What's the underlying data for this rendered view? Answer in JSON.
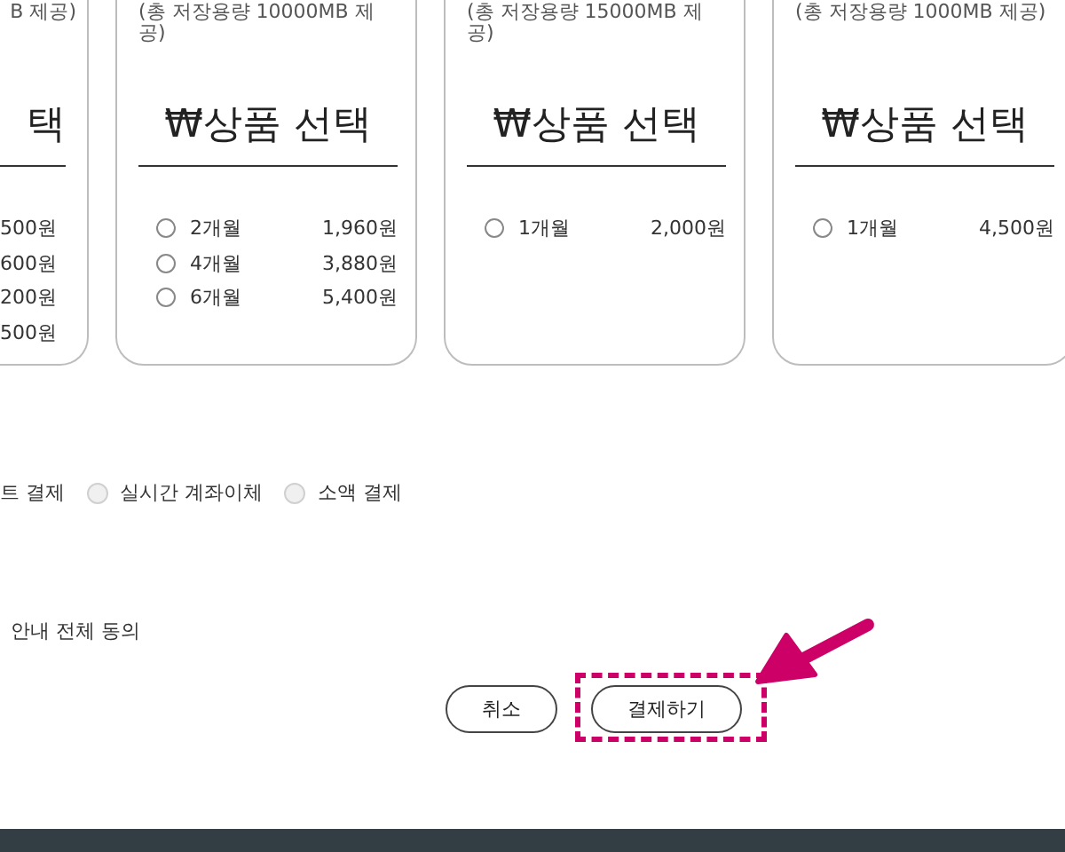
{
  "plan_cards": [
    {
      "kind": "cut",
      "storage_note": "B 제공)",
      "title": "택",
      "options": [
        {
          "price": "500원"
        },
        {
          "price": "600원"
        },
        {
          "price": "200원"
        },
        {
          "price": "500원"
        }
      ]
    },
    {
      "kind": "full",
      "storage_note": "(총 저장용량 10000MB 제공)",
      "title": "₩상품 선택",
      "options": [
        {
          "period": "2개월",
          "price": "1,960원",
          "selected": false
        },
        {
          "period": "4개월",
          "price": "3,880원",
          "selected": false
        },
        {
          "period": "6개월",
          "price": "5,400원",
          "selected": false
        }
      ]
    },
    {
      "kind": "full",
      "storage_note": "(총 저장용량 15000MB 제공)",
      "title": "₩상품 선택",
      "options": [
        {
          "period": "1개월",
          "price": "2,000원",
          "selected": false
        }
      ]
    },
    {
      "kind": "full",
      "storage_note": "(총 저장용량 1000MB 제공)",
      "title": "₩상품 선택",
      "options": [
        {
          "period": "1개월",
          "price": "4,500원",
          "selected": false
        }
      ]
    }
  ],
  "payment_methods": [
    {
      "kind": "cut",
      "label": "트 결제"
    },
    {
      "kind": "option",
      "label": "실시간 계좌이체",
      "selected": false
    },
    {
      "kind": "option",
      "label": "소액 결제",
      "selected": false
    }
  ],
  "agreement": {
    "label": "안내 전체 동의"
  },
  "buttons": [
    {
      "kind": "cancel",
      "label": "취소",
      "highlighted": false
    },
    {
      "kind": "submit",
      "label": "결제하기",
      "highlighted": true
    }
  ]
}
